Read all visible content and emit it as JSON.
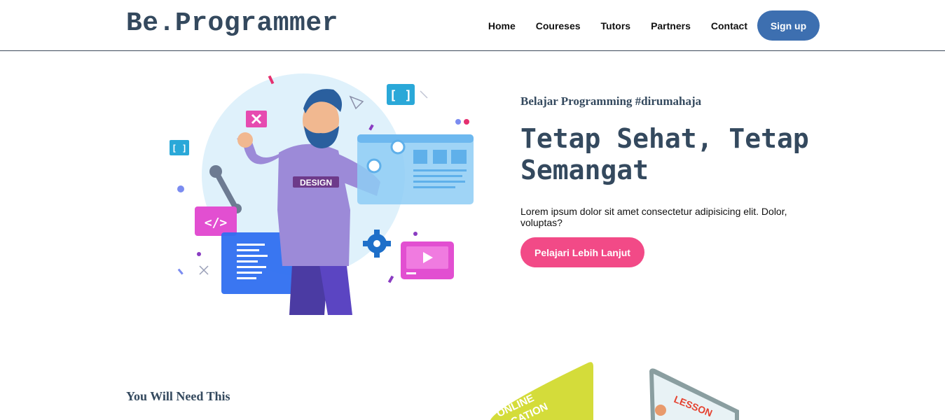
{
  "header": {
    "logo": "Be.Programmer",
    "nav": [
      "Home",
      "Coureses",
      "Tutors",
      "Partners",
      "Contact"
    ],
    "signup_label": "Sign up"
  },
  "hero": {
    "tagline": "Belajar Programming #dirumahaja",
    "headline": "Tetap Sehat, Tetap Semangat",
    "description": "Lorem ipsum dolor sit amet consectetur adipisicing elit. Dolor, voluptas?",
    "cta_label": "Pelajari Lebih Lanjut",
    "illustration_badge": "DESIGN"
  },
  "section": {
    "title": "You Will Need This",
    "card_left_text": "ONLINE\nCATION",
    "card_right_text": "LESSON"
  },
  "colors": {
    "brand": "#34495e",
    "signup": "#3d6fb0",
    "cta": "#f24a87",
    "card_yellow": "#d4dc3a"
  }
}
